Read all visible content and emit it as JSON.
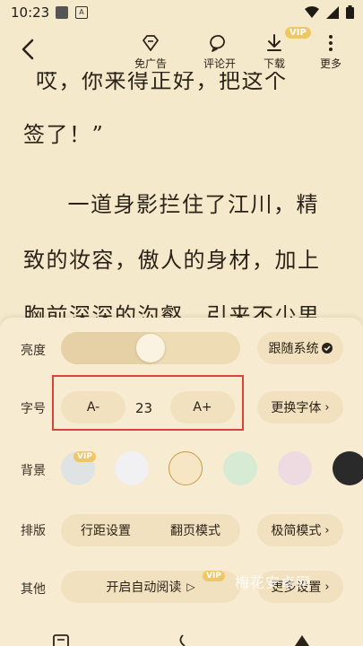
{
  "status": {
    "time": "10:23",
    "notif_icon": "A"
  },
  "toolbar": {
    "back_icon": "back-arrow-icon",
    "items": [
      {
        "label": "免广告",
        "icon": "diamond-icon"
      },
      {
        "label": "评论开",
        "icon": "comment-icon"
      },
      {
        "label": "下载",
        "icon": "download-icon",
        "badge": "VIP"
      },
      {
        "label": "更多",
        "icon": "more-icon"
      }
    ]
  },
  "reader": {
    "lines": [
      "哎，你来得正好，把这个",
      "签了！”",
      "　一道身影拦住了江川，精",
      "致的妆容，傲人的身材，加上",
      "胸前深深的沟壑，引来不少男"
    ]
  },
  "settings": {
    "brightness": {
      "label": "亮度",
      "follow_system": "跟随系统",
      "level": 0.5
    },
    "font_size": {
      "label": "字号",
      "decrease": "A-",
      "value": "23",
      "increase": "A+",
      "change_font": "更换字体"
    },
    "background": {
      "label": "背景",
      "vip_badge": "VIP",
      "swatches": [
        "#dfe3e4",
        "#f1f0f2",
        "#f6e6c4",
        "#d6ead4",
        "#eedbe2",
        "#2a2a2a"
      ]
    },
    "layout": {
      "label": "排版",
      "line_spacing": "行距设置",
      "page_mode": "翻页模式",
      "simple_mode": "极简模式"
    },
    "other": {
      "label": "其他",
      "auto_read": "开启自动阅读",
      "vip_badge": "VIP",
      "more": "更多设置"
    }
  },
  "watermark": "梅花安卓网",
  "colors": {
    "page_bg": "#f5e9cc",
    "panel_bg": "#f7ecd2",
    "pill_bg": "#f1e1bf",
    "highlight": "#d9443a",
    "vip": "#f0c766"
  }
}
